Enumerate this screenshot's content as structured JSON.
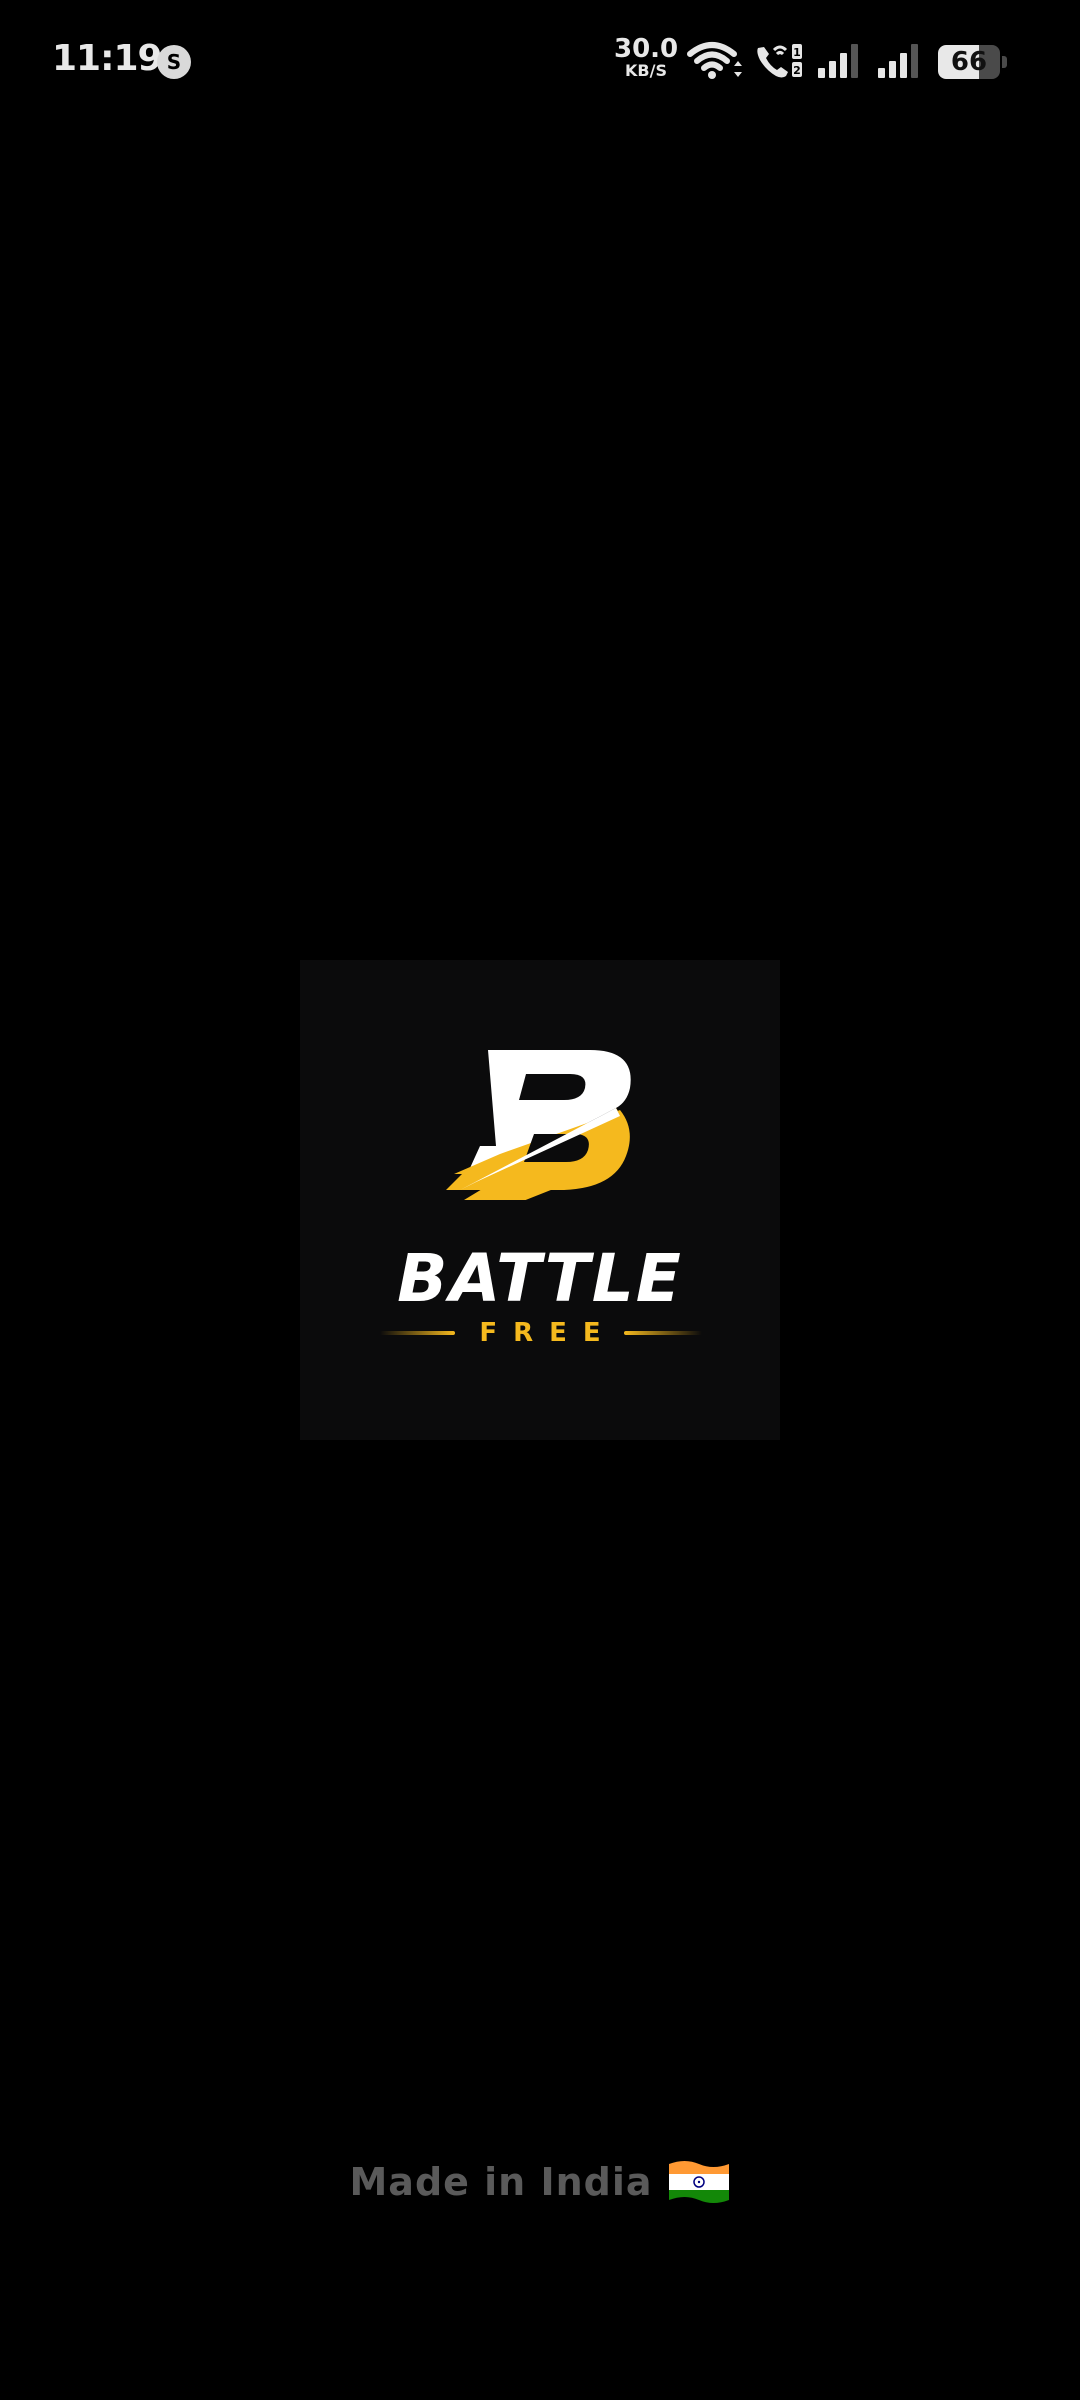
{
  "status_bar": {
    "time": "11:19",
    "notification_icon": "shazam-icon",
    "net_speed_value": "30.0",
    "net_speed_unit": "KB/S",
    "wifi_icon": "wifi-icon",
    "call_icon": "wifi-calling-icon",
    "signal_icons": [
      "signal-sim1-icon",
      "signal-sim2-icon"
    ],
    "battery_level": "66",
    "battery_fraction": 0.66
  },
  "splash": {
    "logo_wordmark": "BATTLE",
    "logo_subtitle": "FREE",
    "logo_icon": "lightning-b-logo-icon",
    "colors": {
      "accent": "#f5b91e",
      "wordmark": "#ffffff",
      "card_bg": "#0b0b0c",
      "page_bg": "#000000"
    }
  },
  "footer": {
    "text": "Made in India",
    "flag_icon": "india-flag-icon"
  }
}
